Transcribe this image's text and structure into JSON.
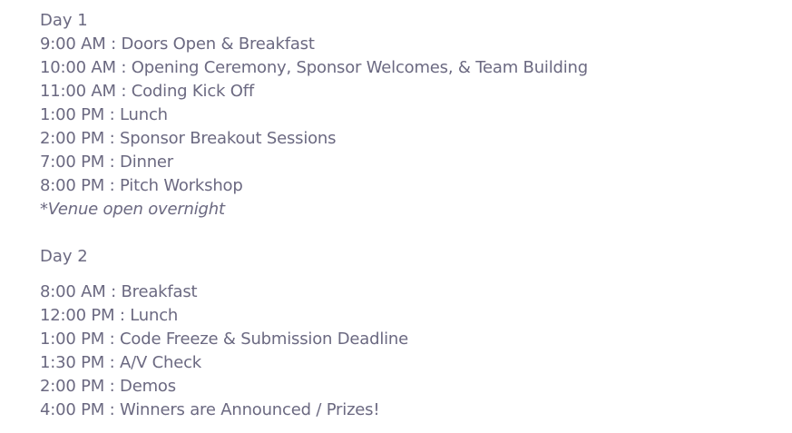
{
  "day1": {
    "heading": "Day 1",
    "items": [
      "9:00 AM : Doors Open & Breakfast",
      "10:00 AM : Opening Ceremony, Sponsor Welcomes, & Team Building",
      "11:00 AM : Coding Kick Off",
      "1:00 PM : Lunch",
      "2:00 PM : Sponsor Breakout Sessions",
      "7:00 PM : Dinner",
      "8:00 PM : Pitch Workshop"
    ],
    "note": "*Venue open overnight"
  },
  "day2": {
    "heading": "Day 2",
    "items": [
      "8:00 AM : Breakfast",
      "12:00 PM : Lunch",
      "1:00 PM : Code Freeze & Submission Deadline",
      "1:30 PM : A/V Check",
      "2:00 PM : Demos",
      "4:00 PM : Winners are Announced / Prizes!"
    ]
  }
}
